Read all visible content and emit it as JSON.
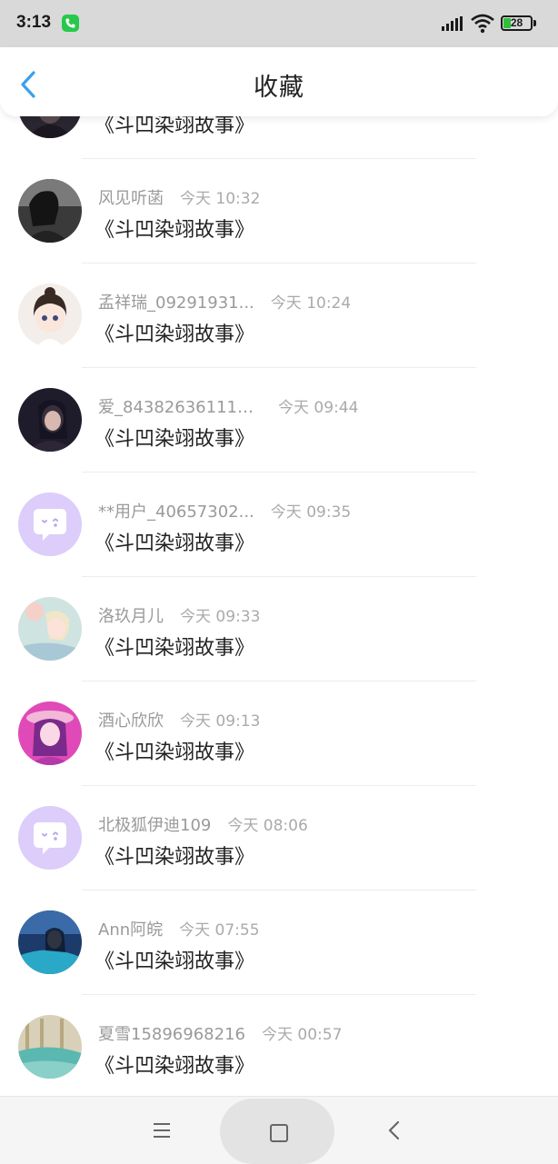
{
  "status_bar": {
    "time": "3:13",
    "battery": "28"
  },
  "header": {
    "title": "收藏"
  },
  "items": [
    {
      "name": "",
      "time": "",
      "book": "《斗凹染翊故事》",
      "avatar": "dark-girl"
    },
    {
      "name": "风见听菡",
      "time": "今天 10:32",
      "book": "《斗凹染翊故事》",
      "avatar": "bw-girl"
    },
    {
      "name": "孟祥瑞_09291931...",
      "time": "今天 10:24",
      "book": "《斗凹染翊故事》",
      "avatar": "cartoon-girl"
    },
    {
      "name": "爱_843826361118...",
      "time": "今天 09:44",
      "book": "《斗凹染翊故事》",
      "avatar": "dark-girl"
    },
    {
      "name": "**用户_40657302...",
      "time": "今天 09:35",
      "book": "《斗凹染翊故事》",
      "avatar": "default-chat"
    },
    {
      "name": "洛玖月儿",
      "time": "今天 09:33",
      "book": "《斗凹染翊故事》",
      "avatar": "anime-pastel"
    },
    {
      "name": "酒心欣欣",
      "time": "今天 09:13",
      "book": "《斗凹染翊故事》",
      "avatar": "anime-pink"
    },
    {
      "name": "北极狐伊迪109",
      "time": "今天 08:06",
      "book": "《斗凹染翊故事》",
      "avatar": "default-chat"
    },
    {
      "name": "Ann阿皖",
      "time": "今天 07:55",
      "book": "《斗凹染翊故事》",
      "avatar": "blue-scene"
    },
    {
      "name": "夏雪15896968216",
      "time": "今天 00:57",
      "book": "《斗凹染翊故事》",
      "avatar": "teal-scene"
    }
  ],
  "colors": {
    "accent": "#3aa0ee",
    "default_avatar": "#dccdfb"
  }
}
